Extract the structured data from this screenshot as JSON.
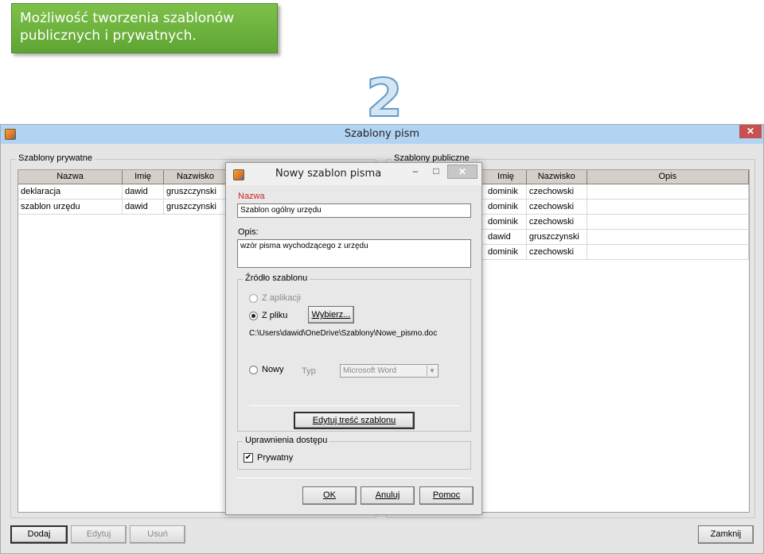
{
  "callout": {
    "line1": "Możliwość tworzenia szablonów",
    "line2": "publicznych i prywatnych."
  },
  "step_number": "2",
  "main_window": {
    "title": "Szablony pism",
    "close_symbol": "✕",
    "private_group": {
      "legend": "Szablony prywatne",
      "columns": [
        "Nazwa",
        "Imię",
        "Nazwisko"
      ],
      "rows": [
        [
          "deklaracja",
          "dawid",
          "gruszczynski"
        ],
        [
          "szablon urzędu",
          "dawid",
          "gruszczynski"
        ]
      ]
    },
    "public_group": {
      "legend": "Szablony publiczne",
      "columns": [
        "Imię",
        "Nazwisko",
        "Opis"
      ],
      "rows": [
        [
          "dominik",
          "czechowski",
          ""
        ],
        [
          "dominik",
          "czechowski",
          ""
        ],
        [
          "dominik",
          "czechowski",
          ""
        ],
        [
          "dawid",
          "gruszczynski",
          ""
        ],
        [
          "dominik",
          "czechowski",
          ""
        ]
      ]
    },
    "buttons": {
      "add": "Dodaj",
      "edit": "Edytuj",
      "delete": "Usuń",
      "close": "Zamknij"
    }
  },
  "dialog": {
    "title": "Nowy szablon pisma",
    "controls": {
      "minimize": "–",
      "maximize": "□",
      "close": "✕"
    },
    "name_label": "Nazwa",
    "name_value": "Szablon ogólny urzędu",
    "desc_label": "Opis:",
    "desc_value": "wzór pisma wychodzącego z urzędu",
    "source_group": {
      "legend": "Źródło szablonu",
      "from_app": "Z aplikacji",
      "from_file": "Z pliku",
      "choose_button": "Wybierz...",
      "file_path": "C:\\Users\\dawid\\OneDrive\\Szablony\\Nowe_pismo.doc",
      "new": "Nowy",
      "type_label": "Typ",
      "type_value": "Microsoft Word",
      "edit_content_button": "Edytuj treść szablonu"
    },
    "permissions_group": {
      "legend": "Uprawnienia dostępu",
      "private_label": "Prywatny",
      "private_checked": true,
      "check_symbol": "✔"
    },
    "buttons": {
      "ok": "OK",
      "cancel": "Anuluj",
      "help": "Pomoc"
    }
  },
  "colors": {
    "callout": "#6bb33e",
    "titlebar": "#b2d4f3",
    "close_red": "#c75050",
    "required_label": "#d02020"
  },
  "icons": [
    "app-icon",
    "close-icon",
    "minimize-icon",
    "maximize-icon",
    "chevron-down-icon",
    "check-icon"
  ]
}
